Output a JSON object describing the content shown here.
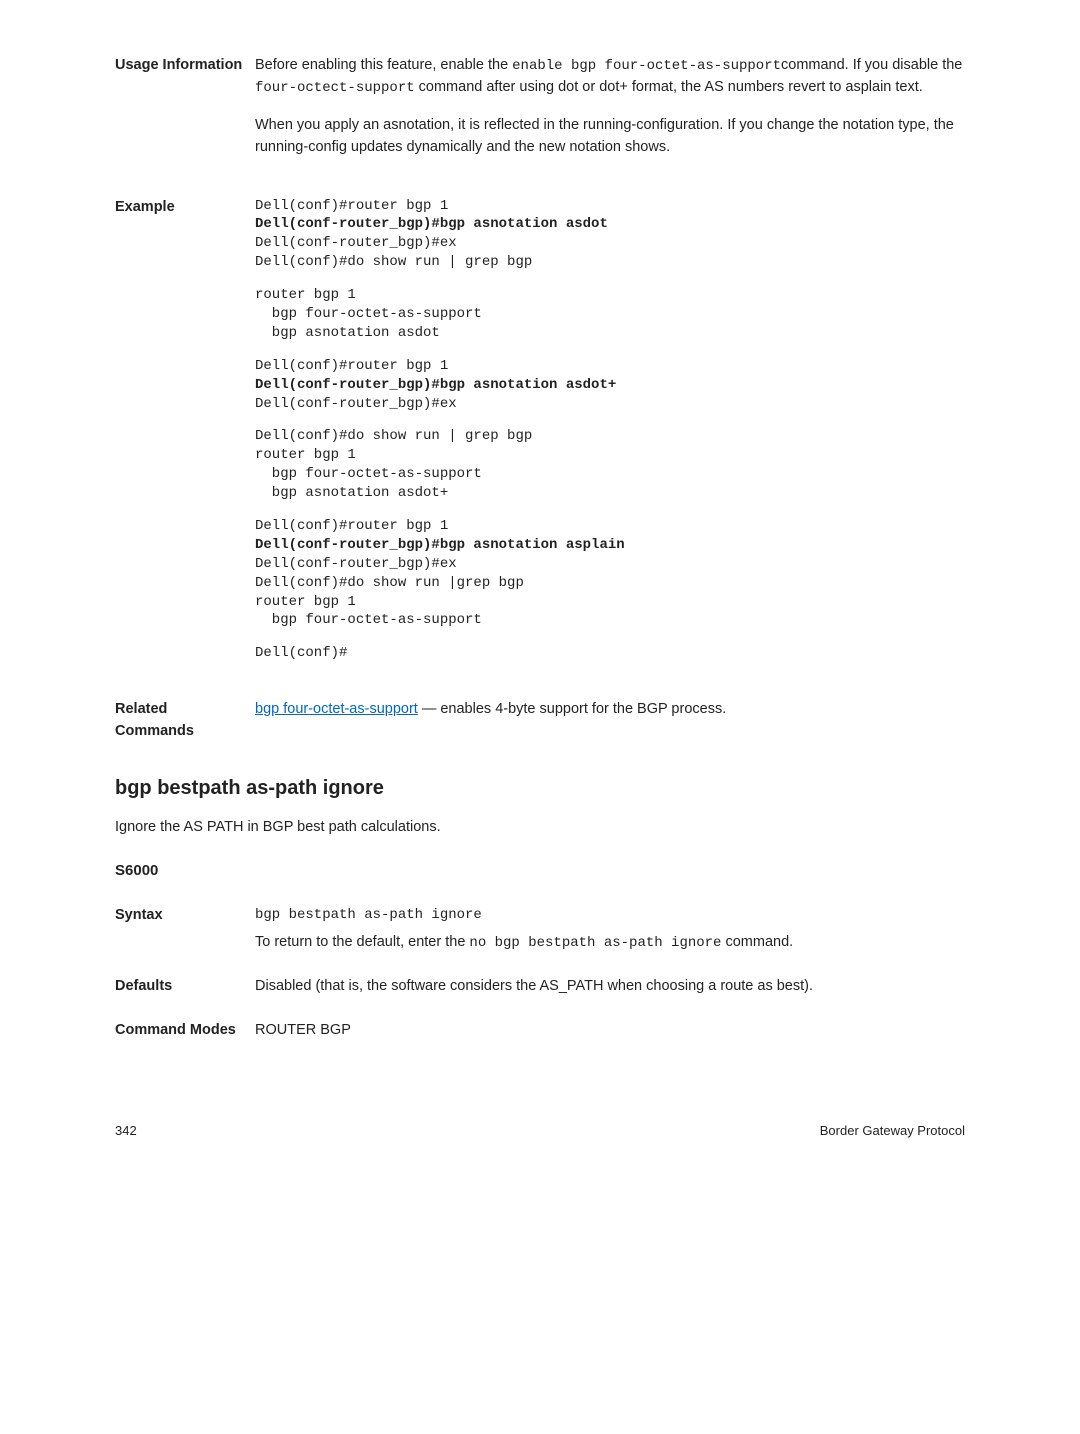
{
  "usage": {
    "label": "Usage Information",
    "para1_pre": "Before enabling this feature, enable the ",
    "code1": "enable bgp four-octet-as-support",
    "para1_mid": "command. If you disable the ",
    "code2": "four-octect-support",
    "para1_post": " command after using dot or dot+ format, the AS numbers revert to asplain text.",
    "para2": "When you apply an asnotation, it is reflected in the running-configuration. If you change the notation type, the running-config updates dynamically and the new notation shows."
  },
  "example": {
    "label": "Example",
    "block1_l1": "Dell(conf)#router bgp 1",
    "block1_l2": "Dell(conf-router_bgp)#bgp asnotation asdot",
    "block1_l3": "Dell(conf-router_bgp)#ex",
    "block1_l4": "Dell(conf)#do show run | grep bgp",
    "block2_l1": "router bgp 1",
    "block2_l2": "  bgp four-octet-as-support",
    "block2_l3": "  bgp asnotation asdot",
    "block3_l1": "Dell(conf)#router bgp 1",
    "block3_l2": "Dell(conf-router_bgp)#bgp asnotation asdot+",
    "block3_l3": "Dell(conf-router_bgp)#ex",
    "block4_l1": "Dell(conf)#do show run | grep bgp",
    "block4_l2": "router bgp 1",
    "block4_l3": "  bgp four-octet-as-support",
    "block4_l4": "  bgp asnotation asdot+",
    "block5_l1": "Dell(conf)#router bgp 1",
    "block5_l2": "Dell(conf-router_bgp)#bgp asnotation asplain",
    "block5_l3": "Dell(conf-router_bgp)#ex",
    "block5_l4": "Dell(conf)#do show run |grep bgp",
    "block5_l5": "router bgp 1",
    "block5_l6": "  bgp four-octet-as-support",
    "block6_l1": "Dell(conf)#"
  },
  "related": {
    "label": "Related Commands",
    "link": "bgp four-octet-as-support",
    "text": " — enables 4-byte support for the BGP process."
  },
  "heading": "bgp bestpath as-path ignore",
  "headdesc": "Ignore the AS PATH in BGP best path calculations.",
  "platform": "S6000",
  "syntax": {
    "label": "Syntax",
    "code": "bgp bestpath as-path ignore",
    "text_pre": "To return to the default, enter the ",
    "text_code": "no bgp bestpath as-path ignore",
    "text_post": " command."
  },
  "defaults": {
    "label": "Defaults",
    "text": "Disabled (that is, the software considers the AS_PATH when choosing a route as best)."
  },
  "modes": {
    "label": "Command Modes",
    "text": "ROUTER BGP"
  },
  "footer": {
    "page": "342",
    "title": "Border Gateway Protocol"
  }
}
